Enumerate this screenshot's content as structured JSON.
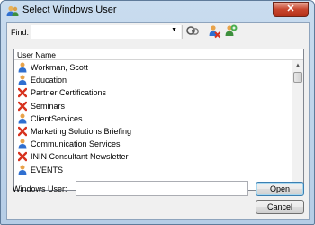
{
  "window": {
    "title": "Select Windows User",
    "close_label": "✕"
  },
  "find": {
    "label": "Find:",
    "value": ""
  },
  "list": {
    "column_header": "User Name",
    "items": [
      {
        "label": "Workman, Scott",
        "icon": "user-icon"
      },
      {
        "label": "Education",
        "icon": "user-icon"
      },
      {
        "label": "Partner Certifications",
        "icon": "excluded-user-icon"
      },
      {
        "label": "Seminars",
        "icon": "excluded-user-icon"
      },
      {
        "label": "ClientServices",
        "icon": "user-icon"
      },
      {
        "label": "Marketing Solutions Briefing",
        "icon": "excluded-user-icon"
      },
      {
        "label": "Communication Services",
        "icon": "user-icon"
      },
      {
        "label": "ININ Consultant Newsletter",
        "icon": "excluded-user-icon"
      },
      {
        "label": "EVENTS",
        "icon": "user-icon"
      }
    ]
  },
  "windows_user": {
    "label": "Windows User:",
    "value": ""
  },
  "buttons": {
    "open": "Open",
    "cancel": "Cancel"
  },
  "colors": {
    "user_icon_body": "#2f6fd0",
    "user_icon_head": "#e8a34a",
    "excluded_x": "#d7321e"
  }
}
